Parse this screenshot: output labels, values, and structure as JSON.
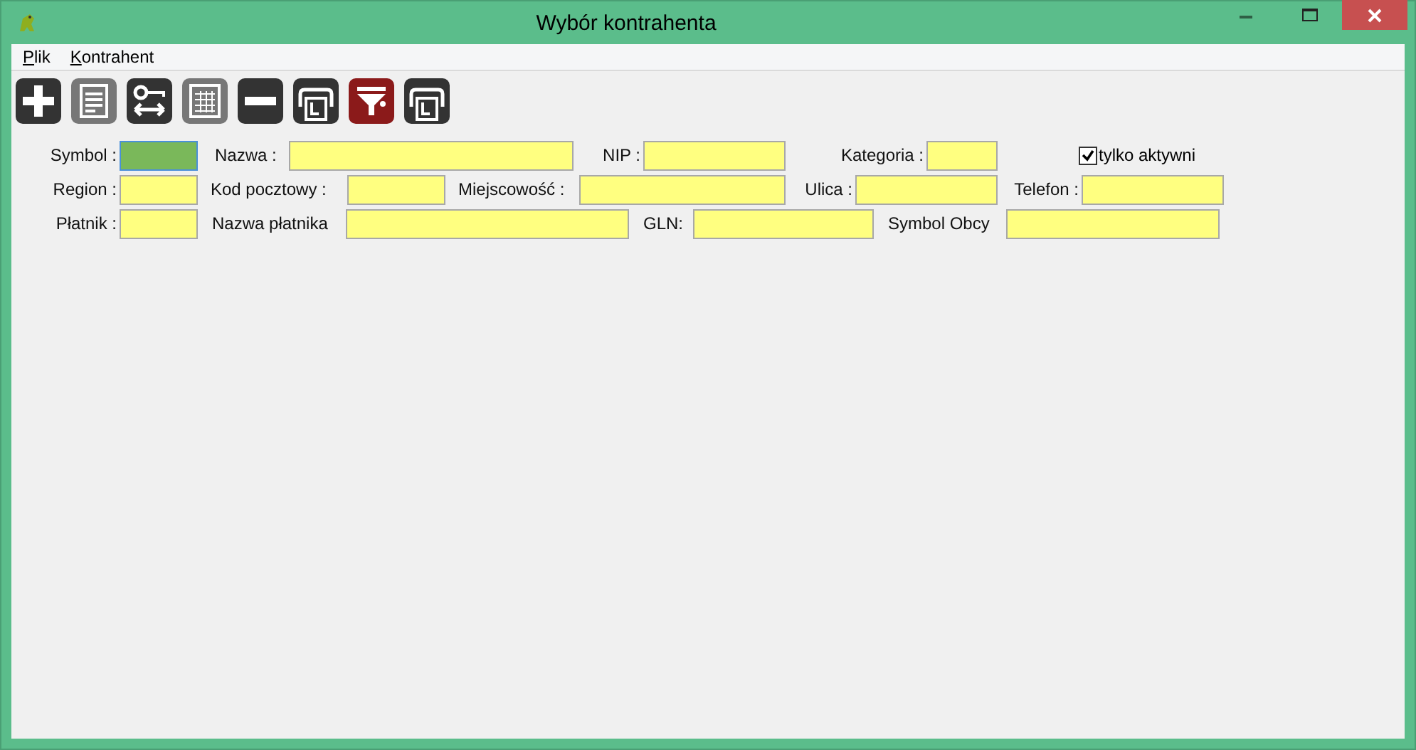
{
  "window": {
    "title": "Wybór kontrahenta"
  },
  "menu": [
    {
      "label": "Plik"
    },
    {
      "label": "Kontrahent"
    }
  ],
  "toolbar": [
    {
      "kind": "plus",
      "disabled": false,
      "active": false
    },
    {
      "kind": "document",
      "disabled": true,
      "active": false
    },
    {
      "kind": "key",
      "disabled": false,
      "active": false
    },
    {
      "kind": "grid",
      "disabled": true,
      "active": false
    },
    {
      "kind": "minus",
      "disabled": false,
      "active": false
    },
    {
      "kind": "printer",
      "disabled": false,
      "active": false
    },
    {
      "kind": "filter",
      "disabled": false,
      "active": true
    },
    {
      "kind": "printer",
      "disabled": false,
      "active": false
    }
  ],
  "form_rows": [
    [
      {
        "label": "Symbol :",
        "focused": true
      },
      {
        "label": "Nazwa :",
        "focused": false
      },
      {
        "label": "NIP :",
        "focused": false
      },
      {
        "label": "Kategoria :",
        "focused": false
      }
    ],
    [
      {
        "label": "Region :",
        "focused": false
      },
      {
        "label": "Kod pocztowy :",
        "focused": false
      },
      {
        "label": "Miejscowość :",
        "focused": false
      },
      {
        "label": "Ulica :",
        "focused": false
      },
      {
        "label": "Telefon :",
        "focused": false
      }
    ],
    [
      {
        "label": "Płatnik :",
        "focused": false
      },
      {
        "label": "Nazwa płatnika",
        "focused": false
      },
      {
        "label": "GLN:",
        "focused": false
      },
      {
        "label": "Symbol Obcy",
        "focused": false
      }
    ]
  ],
  "only_active": {
    "label": "tylko aktywni",
    "checked": true
  }
}
